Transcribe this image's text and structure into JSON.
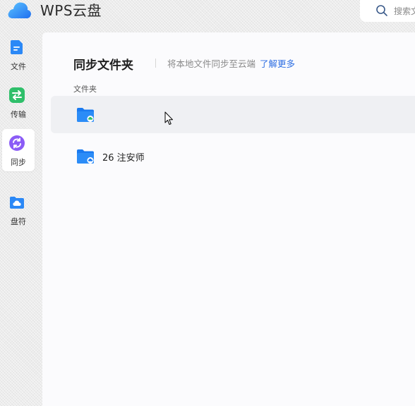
{
  "app": {
    "title": "WPS云盘"
  },
  "search": {
    "placeholder": "搜索文"
  },
  "sidebar": {
    "items": [
      {
        "label": "文件",
        "icon": "file-icon",
        "color": "#2b88f6"
      },
      {
        "label": "传输",
        "icon": "transfer-icon",
        "color": "#2fbf6a"
      },
      {
        "label": "同步",
        "icon": "sync-icon",
        "color": "#8b5cf6",
        "active": true
      },
      {
        "label": "盘符",
        "icon": "drive-folder-icon",
        "color": "#2b88f6"
      }
    ]
  },
  "main": {
    "title": "同步文件夹",
    "subtitle": "将本地文件同步至云端",
    "learn_more": "了解更多",
    "section_label": "文件夹",
    "folders": [
      {
        "name": "",
        "status": "synced-green"
      },
      {
        "name": "26 注安师",
        "status": "cloud-blue"
      }
    ]
  },
  "colors": {
    "accent": "#2f6fe3",
    "folder": "#1a7af0"
  }
}
